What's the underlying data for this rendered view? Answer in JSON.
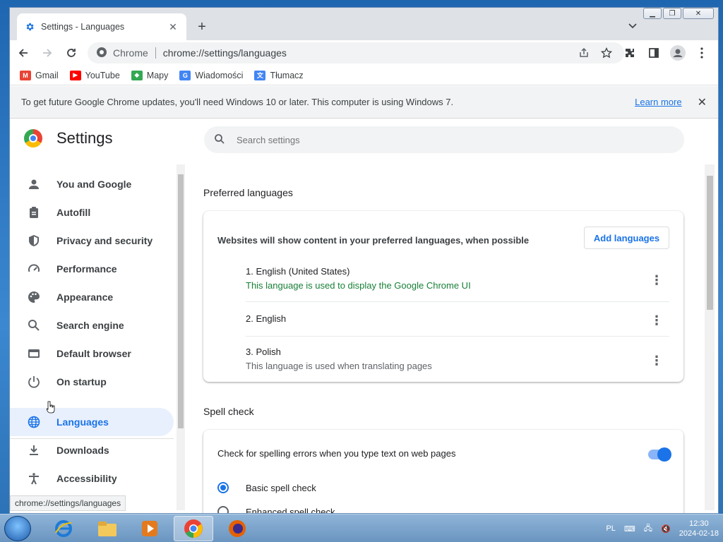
{
  "browser": {
    "tab_title": "Settings - Languages",
    "new_tab": "+",
    "omnibox_label": "Chrome",
    "url": "chrome://settings/languages"
  },
  "bookmarks": [
    {
      "label": "Gmail",
      "icon": "gmail-icon",
      "color": "#ea4335"
    },
    {
      "label": "YouTube",
      "icon": "youtube-icon",
      "color": "#ff0000"
    },
    {
      "label": "Mapy",
      "icon": "maps-icon",
      "color": "#34a853"
    },
    {
      "label": "Wiadomości",
      "icon": "news-icon",
      "color": "#4285f4"
    },
    {
      "label": "Tłumacz",
      "icon": "translate-icon",
      "color": "#4285f4"
    }
  ],
  "infobar": {
    "message": "To get future Google Chrome updates, you'll need Windows 10 or later. This computer is using Windows 7.",
    "link": "Learn more"
  },
  "settings": {
    "title": "Settings",
    "search_placeholder": "Search settings"
  },
  "sidebar": {
    "items": [
      {
        "label": "You and Google",
        "icon": "person-icon"
      },
      {
        "label": "Autofill",
        "icon": "clipboard-icon"
      },
      {
        "label": "Privacy and security",
        "icon": "shield-icon"
      },
      {
        "label": "Performance",
        "icon": "speedometer-icon"
      },
      {
        "label": "Appearance",
        "icon": "palette-icon"
      },
      {
        "label": "Search engine",
        "icon": "search-icon"
      },
      {
        "label": "Default browser",
        "icon": "browser-icon"
      },
      {
        "label": "On startup",
        "icon": "power-icon"
      },
      {
        "label": "Languages",
        "icon": "globe-icon"
      },
      {
        "label": "Downloads",
        "icon": "download-icon"
      },
      {
        "label": "Accessibility",
        "icon": "accessibility-icon"
      }
    ],
    "active": "Languages"
  },
  "status_url": "chrome://settings/languages",
  "preferred": {
    "section_title": "Preferred languages",
    "description": "Websites will show content in your preferred languages, when possible",
    "add_button": "Add languages",
    "languages": [
      {
        "name": "1. English (United States)",
        "note": "This language is used to display the Google Chrome UI",
        "note_color": "#188038"
      },
      {
        "name": "2. English",
        "note": ""
      },
      {
        "name": "3. Polish",
        "note": "This language is used when translating pages",
        "note_color": "#5f6368"
      }
    ]
  },
  "spell": {
    "section_title": "Spell check",
    "toggle_label": "Check for spelling errors when you type text on web pages",
    "toggle_on": true,
    "options": [
      {
        "label": "Basic spell check",
        "selected": true
      },
      {
        "label": "Enhanced spell check",
        "selected": false
      }
    ]
  },
  "taskbar": {
    "lang": "PL",
    "time": "12:30",
    "date": "2024-02-18"
  }
}
